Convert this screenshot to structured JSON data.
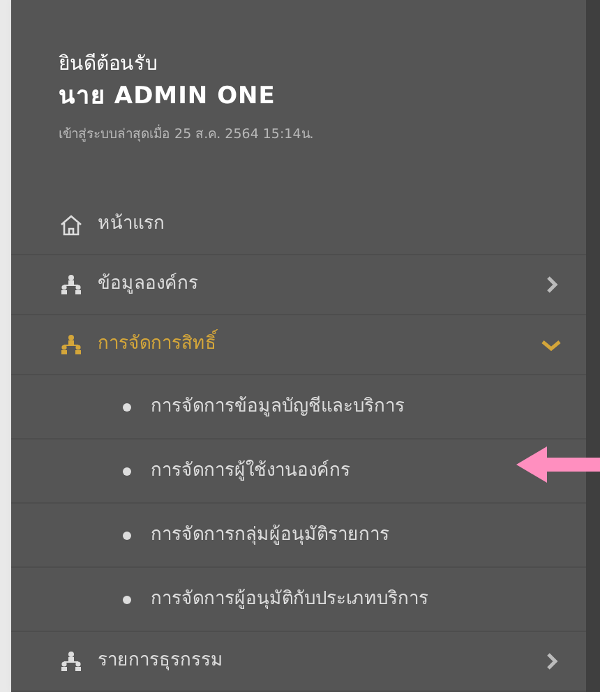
{
  "welcome": {
    "greeting": "ยินดีต้อนรับ",
    "user_name": "นาย ADMIN ONE",
    "last_login": "เข้าสู่ระบบล่าสุดเมื่อ 25 ส.ค. 2564 15:14น."
  },
  "menu": [
    {
      "label": "หน้าแรก",
      "kind": "home",
      "selected": false
    },
    {
      "label": "ข้อมูลองค์กร",
      "kind": "group",
      "selected": false,
      "expanded": false
    },
    {
      "label": "การจัดการสิทธิ์",
      "kind": "group",
      "selected": true,
      "expanded": true,
      "children": [
        {
          "label": "การจัดการข้อมูลบัญชีและบริการ",
          "selected": false
        },
        {
          "label": "การจัดการผู้ใช้งานองค์กร",
          "selected": false
        },
        {
          "label": "การจัดการกลุ่มผู้อนุมัติรายการ",
          "selected": false
        },
        {
          "label": "การจัดการผู้อนุมัติกับประเภทบริการ",
          "selected": false
        }
      ]
    },
    {
      "label": "รายการธุรกรรม",
      "kind": "group",
      "selected": false,
      "expanded": false
    }
  ]
}
